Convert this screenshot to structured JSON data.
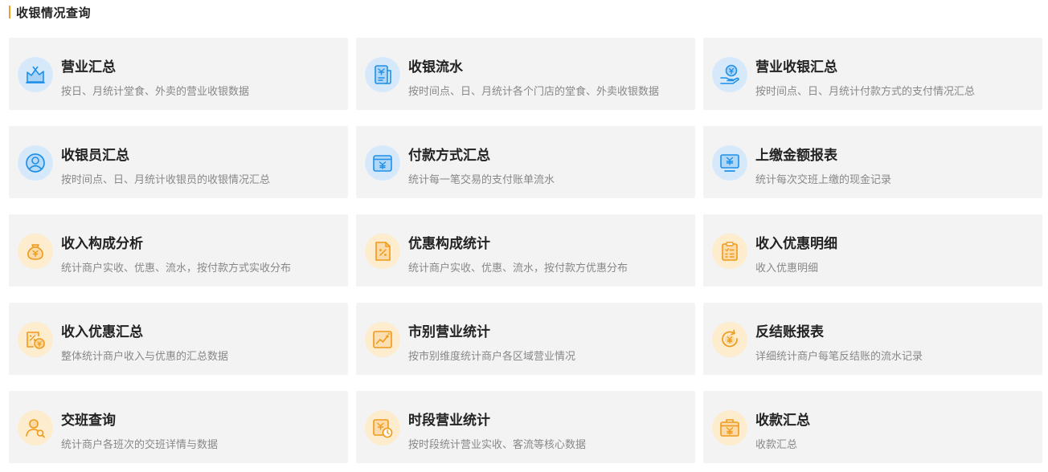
{
  "section": {
    "title": "收银情况查询",
    "accent_color": "#f0a020"
  },
  "colors": {
    "card_background": "#f3f3f3",
    "blue_icon": "#1e90e8",
    "blue_icon_bg": "#d6e9fb",
    "orange_icon": "#f09a1a",
    "orange_icon_bg": "#fdeccd"
  },
  "cards": [
    {
      "name": "business-summary",
      "title": "营业汇总",
      "desc": "按日、月统计堂食、外卖的营业收银数据",
      "icon": "chart-area-icon",
      "tone": "blue"
    },
    {
      "name": "cashier-flow",
      "title": "收银流水",
      "desc": "按时间点、日、月统计各个门店的堂食、外卖收银数据",
      "icon": "receipt-yuan-icon",
      "tone": "blue"
    },
    {
      "name": "business-cashier-summary",
      "title": "营业收银汇总",
      "desc": "按时间点、日、月统计付款方式的支付情况汇总",
      "icon": "hand-coin-icon",
      "tone": "blue"
    },
    {
      "name": "cashier-staff-summary",
      "title": "收银员汇总",
      "desc": "按时间点、日、月统计收银员的收银情况汇总",
      "icon": "user-circle-icon",
      "tone": "blue"
    },
    {
      "name": "payment-method-summary",
      "title": "付款方式汇总",
      "desc": "统计每一笔交易的支付账单流水",
      "icon": "wallet-yuan-icon",
      "tone": "blue"
    },
    {
      "name": "cash-submission-report",
      "title": "上缴金额报表",
      "desc": "统计每次交班上缴的现金记录",
      "icon": "monitor-yuan-icon",
      "tone": "blue"
    },
    {
      "name": "income-composition-analysis",
      "title": "收入构成分析",
      "desc": "统计商户实收、优惠、流水，按付款方式实收分布",
      "icon": "money-bag-icon",
      "tone": "orange"
    },
    {
      "name": "discount-composition-stats",
      "title": "优惠构成统计",
      "desc": "统计商户实收、优惠、流水，按付款方优惠分布",
      "icon": "percent-document-icon",
      "tone": "orange"
    },
    {
      "name": "income-discount-detail",
      "title": "收入优惠明细",
      "desc": "收入优惠明细",
      "icon": "clipboard-list-icon",
      "tone": "orange"
    },
    {
      "name": "income-discount-summary",
      "title": "收入优惠汇总",
      "desc": "整体统计商户收入与优惠的汇总数据",
      "icon": "discount-coin-icon",
      "tone": "orange"
    },
    {
      "name": "city-business-stats",
      "title": "市别营业统计",
      "desc": "按市别维度统计商户各区域营业情况",
      "icon": "trend-chart-icon",
      "tone": "orange"
    },
    {
      "name": "reverse-checkout-report",
      "title": "反结账报表",
      "desc": "详细统计商户每笔反结账的流水记录",
      "icon": "refresh-yuan-icon",
      "tone": "orange"
    },
    {
      "name": "shift-handover-query",
      "title": "交班查询",
      "desc": "统计商户各班次的交班详情与数据",
      "icon": "user-search-icon",
      "tone": "orange"
    },
    {
      "name": "period-business-stats",
      "title": "时段营业统计",
      "desc": "按时段统计营业实收、客流等核心数据",
      "icon": "clock-yuan-icon",
      "tone": "orange"
    },
    {
      "name": "collection-summary",
      "title": "收款汇总",
      "desc": "收款汇总",
      "icon": "briefcase-yuan-icon",
      "tone": "orange"
    }
  ]
}
